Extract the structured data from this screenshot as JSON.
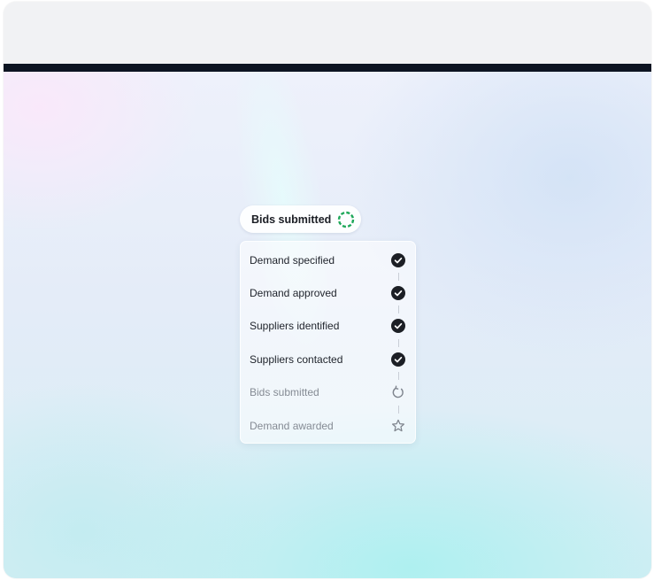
{
  "status_pill": {
    "label": "Bids submitted",
    "icon": "progress-spinner-icon",
    "accent_color": "#1fa85a"
  },
  "steps": [
    {
      "label": "Demand specified",
      "state": "done",
      "icon": "check-circle-icon"
    },
    {
      "label": "Demand approved",
      "state": "done",
      "icon": "check-circle-icon"
    },
    {
      "label": "Suppliers identified",
      "state": "done",
      "icon": "check-circle-icon"
    },
    {
      "label": "Suppliers contacted",
      "state": "done",
      "icon": "check-circle-icon"
    },
    {
      "label": "Bids submitted",
      "state": "in-progress",
      "icon": "refresh-icon"
    },
    {
      "label": "Demand awarded",
      "state": "pending",
      "icon": "star-icon"
    }
  ]
}
